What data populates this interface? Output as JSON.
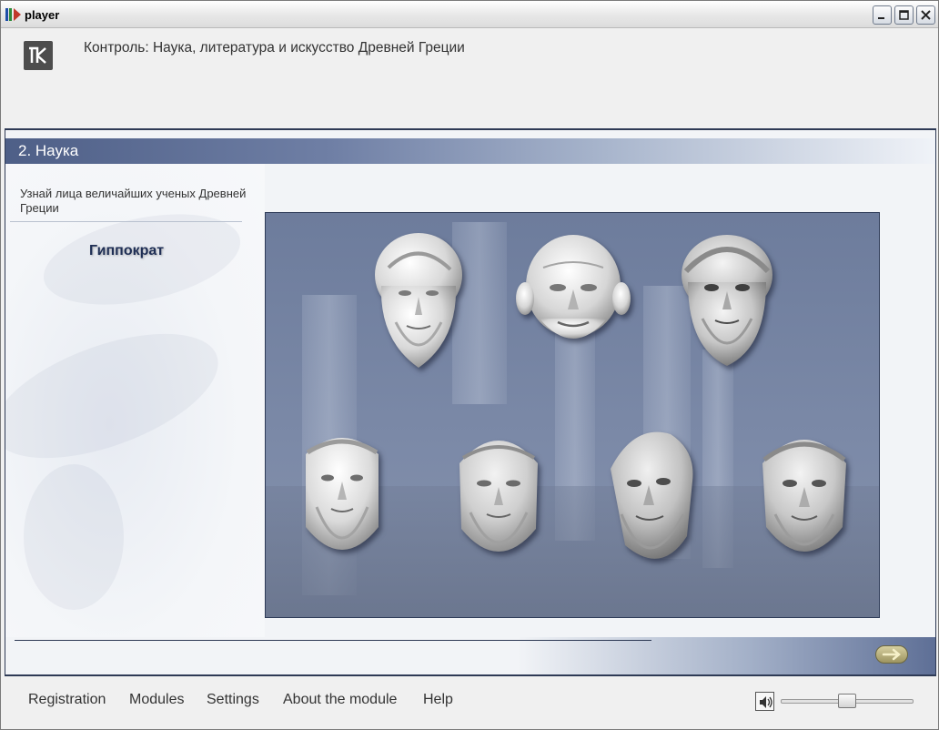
{
  "window": {
    "title": "player",
    "buttons": [
      "minimize",
      "maximize",
      "close"
    ]
  },
  "header": {
    "logo_icon": "k-logo-icon",
    "course_title": "Контроль: Наука, литература и искусство Древней Греции"
  },
  "section": {
    "title": "2. Наука"
  },
  "left_panel": {
    "instruction": "Узнай лица величайших ученых Древней Греции",
    "answer_label": "Гиппократ"
  },
  "stage": {
    "bust_count": 7
  },
  "navigation": {
    "next_icon": "arrow-right-icon"
  },
  "menu": {
    "items": [
      "Registration",
      "Modules",
      "Settings",
      "About the module",
      "Help"
    ]
  },
  "audio": {
    "icon": "speaker-icon",
    "volume_percent": 50
  },
  "colors": {
    "accent": "#4e5f87",
    "frame_border": "#2e3a55",
    "answer_text": "#1f2f55"
  }
}
